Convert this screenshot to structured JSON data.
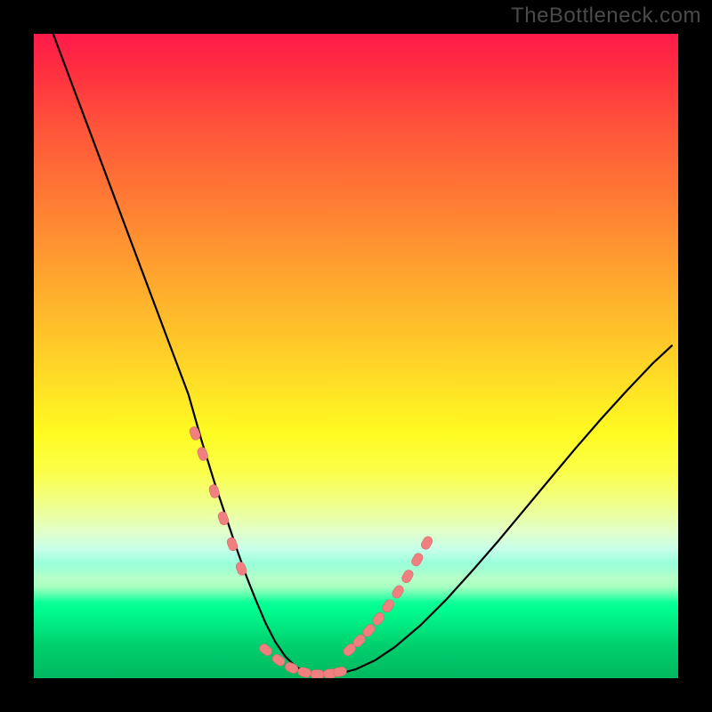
{
  "watermark": "TheBottleneck.com",
  "colors": {
    "background": "#000000",
    "curve": "#000000",
    "marker_fill": "#f08080",
    "marker_stroke": "#d86a6a"
  },
  "chart_data": {
    "type": "line",
    "title": "",
    "xlabel": "",
    "ylabel": "",
    "xlim": [
      0,
      100
    ],
    "ylim": [
      0,
      100
    ],
    "series": [
      {
        "name": "bottleneck-curve",
        "x": [
          3,
          6,
          9,
          12,
          15,
          18,
          21,
          24,
          26,
          28,
          30,
          31.5,
          33,
          34.5,
          36,
          37.5,
          39,
          40.5,
          42,
          44,
          47,
          50,
          53,
          56,
          60,
          64,
          68,
          72,
          76,
          80,
          84,
          88,
          92,
          96,
          99
        ],
        "y": [
          100,
          92,
          84,
          76,
          68,
          60,
          52,
          44,
          37,
          30.5,
          24.5,
          20,
          15.8,
          12,
          8.5,
          5.6,
          3.4,
          1.9,
          1.0,
          0.4,
          0.6,
          1.4,
          2.8,
          4.8,
          8.2,
          12.2,
          16.6,
          21.2,
          26.0,
          30.8,
          35.6,
          40.2,
          44.6,
          48.8,
          51.6
        ]
      }
    ],
    "markers": {
      "name": "highlighted-points",
      "style": "pink-pill",
      "groups": [
        {
          "segment": "left-arm",
          "x": [
            25.0,
            26.2,
            28.0,
            29.4,
            30.8,
            32.2
          ],
          "y": [
            38.0,
            34.8,
            29.0,
            24.8,
            20.8,
            17.0
          ]
        },
        {
          "segment": "valley-floor",
          "x": [
            36.0,
            38.0,
            40.0,
            42.0,
            44.0,
            46.0,
            47.5
          ],
          "y": [
            4.4,
            2.8,
            1.6,
            0.9,
            0.6,
            0.7,
            1.0
          ]
        },
        {
          "segment": "right-arm",
          "x": [
            49.0,
            50.5,
            52.0,
            53.5,
            55.0,
            56.5,
            58.0,
            59.5,
            61.0
          ],
          "y": [
            4.4,
            5.8,
            7.4,
            9.2,
            11.2,
            13.4,
            15.8,
            18.4,
            21.0
          ]
        }
      ]
    }
  }
}
